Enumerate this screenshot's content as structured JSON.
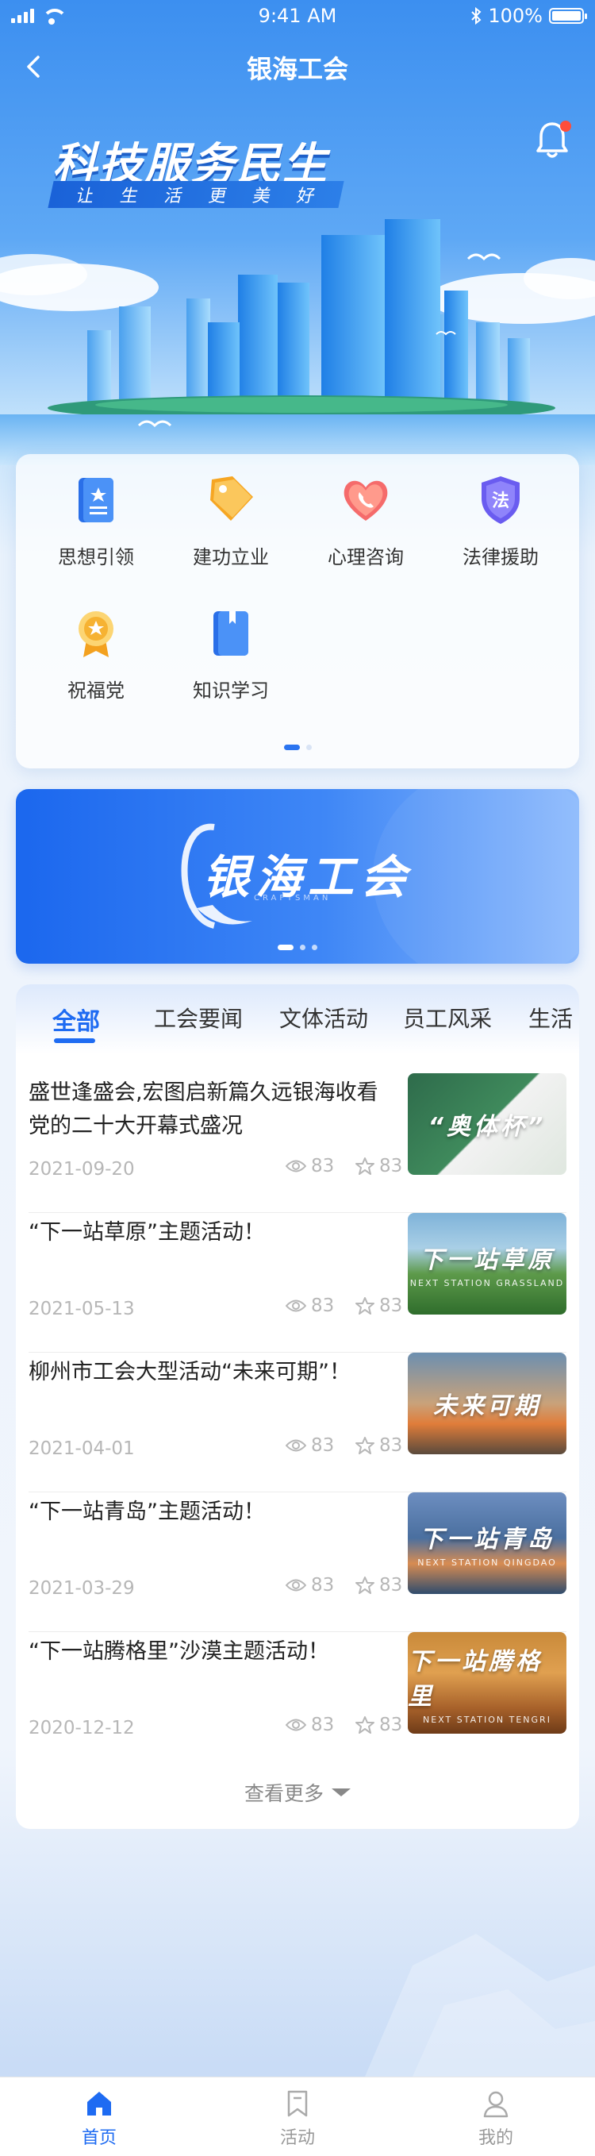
{
  "status_bar": {
    "time": "9:41 AM",
    "battery": "100%"
  },
  "nav": {
    "title": "银海工会"
  },
  "hero": {
    "title": "科技服务民生",
    "subtitle": [
      "让",
      "生",
      "活",
      "更",
      "美",
      "好"
    ]
  },
  "functions": [
    {
      "label": "思想引领",
      "icon": "book-icon"
    },
    {
      "label": "建功立业",
      "icon": "tag-icon"
    },
    {
      "label": "心理咨询",
      "icon": "heart-phone-icon"
    },
    {
      "label": "法律援助",
      "icon": "law-shield-icon"
    },
    {
      "label": "祝福党",
      "icon": "medal-icon"
    },
    {
      "label": "知识学习",
      "icon": "notebook-icon"
    }
  ],
  "banner": {
    "title": "银海工会",
    "subtitle": "CRAFTSMAN"
  },
  "tabs": [
    "全部",
    "工会要闻",
    "文体活动",
    "员工风采",
    "生活"
  ],
  "news": [
    {
      "title": "盛世逢盛会,宏图启新篇久远银海收看党的二十大开幕式盛况",
      "date": "2021-09-20",
      "views": "83",
      "stars": "83",
      "thumb": "“奥体杯”",
      "thumb_sub": ""
    },
    {
      "title": "“下一站草原”主题活动！",
      "date": "2021-05-13",
      "views": "83",
      "stars": "83",
      "thumb": "下一站草原",
      "thumb_sub": "NEXT STATION GRASSLAND"
    },
    {
      "title": "柳州市工会大型活动“未来可期”！",
      "date": "2021-04-01",
      "views": "83",
      "stars": "83",
      "thumb": "未来可期",
      "thumb_sub": ""
    },
    {
      "title": "“下一站青岛”主题活动！",
      "date": "2021-03-29",
      "views": "83",
      "stars": "83",
      "thumb": "下一站青岛",
      "thumb_sub": "NEXT STATION QINGDAO"
    },
    {
      "title": "“下一站腾格里”沙漠主题活动！",
      "date": "2020-12-12",
      "views": "83",
      "stars": "83",
      "thumb": "下一站腾格里",
      "thumb_sub": "NEXT STATION TENGRI"
    }
  ],
  "more_label": "查看更多",
  "tab_bar": [
    {
      "label": "首页",
      "icon": "home-icon",
      "active": true
    },
    {
      "label": "活动",
      "icon": "bookmark-icon",
      "active": false
    },
    {
      "label": "我的",
      "icon": "user-icon",
      "active": false
    }
  ],
  "colors": {
    "primary": "#1e6bf2",
    "accent_red": "#ff4d3a"
  }
}
